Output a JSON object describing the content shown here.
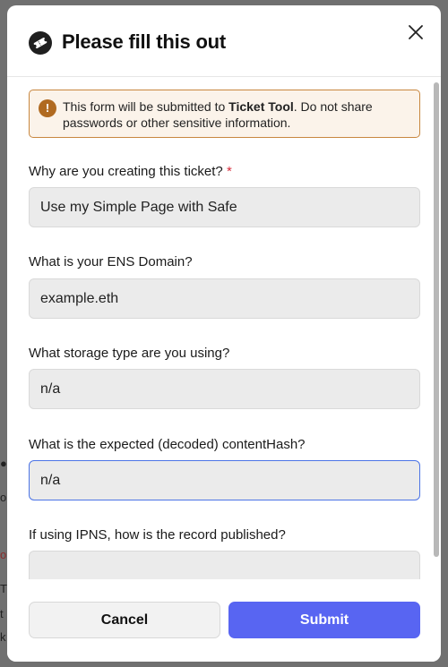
{
  "modal": {
    "title": "Please fill this out",
    "notice": {
      "prefix": "This form will be submitted to ",
      "app_name": "Ticket Tool",
      "suffix": ". Do not share passwords or other sensitive information."
    },
    "fields": [
      {
        "label": "Why are you creating this ticket?",
        "required_mark": "*",
        "value": "Use my Simple Page with Safe"
      },
      {
        "label": "What is your ENS Domain?",
        "value": "example.eth"
      },
      {
        "label": "What storage type are you using?",
        "value": "n/a"
      },
      {
        "label": "What is the expected (decoded) contentHash?",
        "value": "n/a"
      },
      {
        "label": "If using IPNS, how is the record published?",
        "value": ""
      }
    ],
    "buttons": {
      "cancel": "Cancel",
      "submit": "Submit"
    }
  },
  "icons": {
    "header": "ticket-icon",
    "notice": "warning-icon",
    "close": "close-icon"
  },
  "colors": {
    "accent": "#5865f2",
    "notice_border": "#c8873f",
    "notice_bg": "#fbf3ea",
    "required": "#d62b3a",
    "focus": "#4c74e6"
  }
}
